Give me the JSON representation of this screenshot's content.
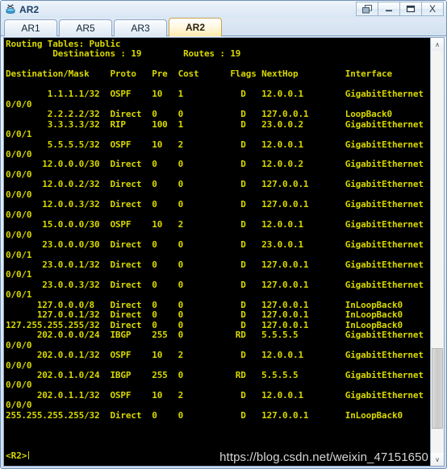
{
  "window": {
    "title": "AR2",
    "icon": "router-icon",
    "buttons": [
      {
        "name": "restore-window-button",
        "glyph": "❐"
      },
      {
        "name": "minimize-window-button",
        "glyph": "–"
      },
      {
        "name": "maximize-window-button",
        "glyph": "❑"
      },
      {
        "name": "close-window-button",
        "glyph": "X"
      }
    ]
  },
  "tabs": [
    {
      "label": "AR1",
      "active": false
    },
    {
      "label": "AR5",
      "active": false
    },
    {
      "label": "AR3",
      "active": false
    },
    {
      "label": "AR2",
      "active": true
    }
  ],
  "terminal": {
    "foreground_color": "#d8d800",
    "background_color": "#000000",
    "header_lines": [
      "Routing Tables: Public",
      "         Destinations : 19        Routes : 19",
      ""
    ],
    "columns": [
      "Destination/Mask",
      "Proto",
      "Pre",
      "Cost",
      "Flags",
      "NextHop",
      "Interface"
    ],
    "column_header_line": "Destination/Mask    Proto   Pre  Cost      Flags NextHop         Interface",
    "routes": [
      {
        "destination": "1.1.1.1/32",
        "proto": "OSPF",
        "pre": "10",
        "cost": "1",
        "flags": "D",
        "nexthop": "12.0.0.1",
        "interface": "GigabitEthernet",
        "interface_wrap": "0/0/0"
      },
      {
        "destination": "2.2.2.2/32",
        "proto": "Direct",
        "pre": "0",
        "cost": "0",
        "flags": "D",
        "nexthop": "127.0.0.1",
        "interface": "LoopBack0",
        "interface_wrap": ""
      },
      {
        "destination": "3.3.3.3/32",
        "proto": "RIP",
        "pre": "100",
        "cost": "1",
        "flags": "D",
        "nexthop": "23.0.0.2",
        "interface": "GigabitEthernet",
        "interface_wrap": "0/0/1"
      },
      {
        "destination": "5.5.5.5/32",
        "proto": "OSPF",
        "pre": "10",
        "cost": "2",
        "flags": "D",
        "nexthop": "12.0.0.1",
        "interface": "GigabitEthernet",
        "interface_wrap": "0/0/0"
      },
      {
        "destination": "12.0.0.0/30",
        "proto": "Direct",
        "pre": "0",
        "cost": "0",
        "flags": "D",
        "nexthop": "12.0.0.2",
        "interface": "GigabitEthernet",
        "interface_wrap": "0/0/0"
      },
      {
        "destination": "12.0.0.2/32",
        "proto": "Direct",
        "pre": "0",
        "cost": "0",
        "flags": "D",
        "nexthop": "127.0.0.1",
        "interface": "GigabitEthernet",
        "interface_wrap": "0/0/0"
      },
      {
        "destination": "12.0.0.3/32",
        "proto": "Direct",
        "pre": "0",
        "cost": "0",
        "flags": "D",
        "nexthop": "127.0.0.1",
        "interface": "GigabitEthernet",
        "interface_wrap": "0/0/0"
      },
      {
        "destination": "15.0.0.0/30",
        "proto": "OSPF",
        "pre": "10",
        "cost": "2",
        "flags": "D",
        "nexthop": "12.0.0.1",
        "interface": "GigabitEthernet",
        "interface_wrap": "0/0/0"
      },
      {
        "destination": "23.0.0.0/30",
        "proto": "Direct",
        "pre": "0",
        "cost": "0",
        "flags": "D",
        "nexthop": "23.0.0.1",
        "interface": "GigabitEthernet",
        "interface_wrap": "0/0/1"
      },
      {
        "destination": "23.0.0.1/32",
        "proto": "Direct",
        "pre": "0",
        "cost": "0",
        "flags": "D",
        "nexthop": "127.0.0.1",
        "interface": "GigabitEthernet",
        "interface_wrap": "0/0/1"
      },
      {
        "destination": "23.0.0.3/32",
        "proto": "Direct",
        "pre": "0",
        "cost": "0",
        "flags": "D",
        "nexthop": "127.0.0.1",
        "interface": "GigabitEthernet",
        "interface_wrap": "0/0/1"
      },
      {
        "destination": "127.0.0.0/8",
        "proto": "Direct",
        "pre": "0",
        "cost": "0",
        "flags": "D",
        "nexthop": "127.0.0.1",
        "interface": "InLoopBack0",
        "interface_wrap": ""
      },
      {
        "destination": "127.0.0.1/32",
        "proto": "Direct",
        "pre": "0",
        "cost": "0",
        "flags": "D",
        "nexthop": "127.0.0.1",
        "interface": "InLoopBack0",
        "interface_wrap": ""
      },
      {
        "destination": "127.255.255.255/32",
        "proto": "Direct",
        "pre": "0",
        "cost": "0",
        "flags": "D",
        "nexthop": "127.0.0.1",
        "interface": "InLoopBack0",
        "interface_wrap": ""
      },
      {
        "destination": "202.0.0.0/24",
        "proto": "IBGP",
        "pre": "255",
        "cost": "0",
        "flags": "RD",
        "nexthop": "5.5.5.5",
        "interface": "GigabitEthernet",
        "interface_wrap": "0/0/0"
      },
      {
        "destination": "202.0.0.1/32",
        "proto": "OSPF",
        "pre": "10",
        "cost": "2",
        "flags": "D",
        "nexthop": "12.0.0.1",
        "interface": "GigabitEthernet",
        "interface_wrap": "0/0/0"
      },
      {
        "destination": "202.0.1.0/24",
        "proto": "IBGP",
        "pre": "255",
        "cost": "0",
        "flags": "RD",
        "nexthop": "5.5.5.5",
        "interface": "GigabitEthernet",
        "interface_wrap": "0/0/0"
      },
      {
        "destination": "202.0.1.1/32",
        "proto": "OSPF",
        "pre": "10",
        "cost": "2",
        "flags": "D",
        "nexthop": "12.0.0.1",
        "interface": "GigabitEthernet",
        "interface_wrap": "0/0/0"
      },
      {
        "destination": "255.255.255.255/32",
        "proto": "Direct",
        "pre": "0",
        "cost": "0",
        "flags": "D",
        "nexthop": "127.0.0.1",
        "interface": "InLoopBack0",
        "interface_wrap": ""
      }
    ],
    "body_text": "Routing Tables: Public\n         Destinations : 19        Routes : 19\n\nDestination/Mask    Proto   Pre  Cost      Flags NextHop         Interface\n\n        1.1.1.1/32  OSPF    10   1           D   12.0.0.1        GigabitEthernet\n0/0/0\n        2.2.2.2/32  Direct  0    0           D   127.0.0.1       LoopBack0\n        3.3.3.3/32  RIP     100  1           D   23.0.0.2        GigabitEthernet\n0/0/1\n        5.5.5.5/32  OSPF    10   2           D   12.0.0.1        GigabitEthernet\n0/0/0\n       12.0.0.0/30  Direct  0    0           D   12.0.0.2        GigabitEthernet\n0/0/0\n       12.0.0.2/32  Direct  0    0           D   127.0.0.1       GigabitEthernet\n0/0/0\n       12.0.0.3/32  Direct  0    0           D   127.0.0.1       GigabitEthernet\n0/0/0\n       15.0.0.0/30  OSPF    10   2           D   12.0.0.1        GigabitEthernet\n0/0/0\n       23.0.0.0/30  Direct  0    0           D   23.0.0.1        GigabitEthernet\n0/0/1\n       23.0.0.1/32  Direct  0    0           D   127.0.0.1       GigabitEthernet\n0/0/1\n       23.0.0.3/32  Direct  0    0           D   127.0.0.1       GigabitEthernet\n0/0/1\n      127.0.0.0/8   Direct  0    0           D   127.0.0.1       InLoopBack0\n      127.0.0.1/32  Direct  0    0           D   127.0.0.1       InLoopBack0\n127.255.255.255/32  Direct  0    0           D   127.0.0.1       InLoopBack0\n      202.0.0.0/24  IBGP    255  0          RD   5.5.5.5         GigabitEthernet\n0/0/0\n      202.0.0.1/32  OSPF    10   2           D   12.0.0.1        GigabitEthernet\n0/0/0\n      202.0.1.0/24  IBGP    255  0          RD   5.5.5.5         GigabitEthernet\n0/0/0\n      202.0.1.1/32  OSPF    10   2           D   12.0.0.1        GigabitEthernet\n0/0/0\n255.255.255.255/32  Direct  0    0           D   127.0.0.1       InLoopBack0",
    "prompt": "<R2>",
    "watermark": "https://blog.csdn.net/weixin_47151650"
  },
  "scrollbar": {
    "up_arrow": "∧",
    "down_arrow": "∨"
  }
}
